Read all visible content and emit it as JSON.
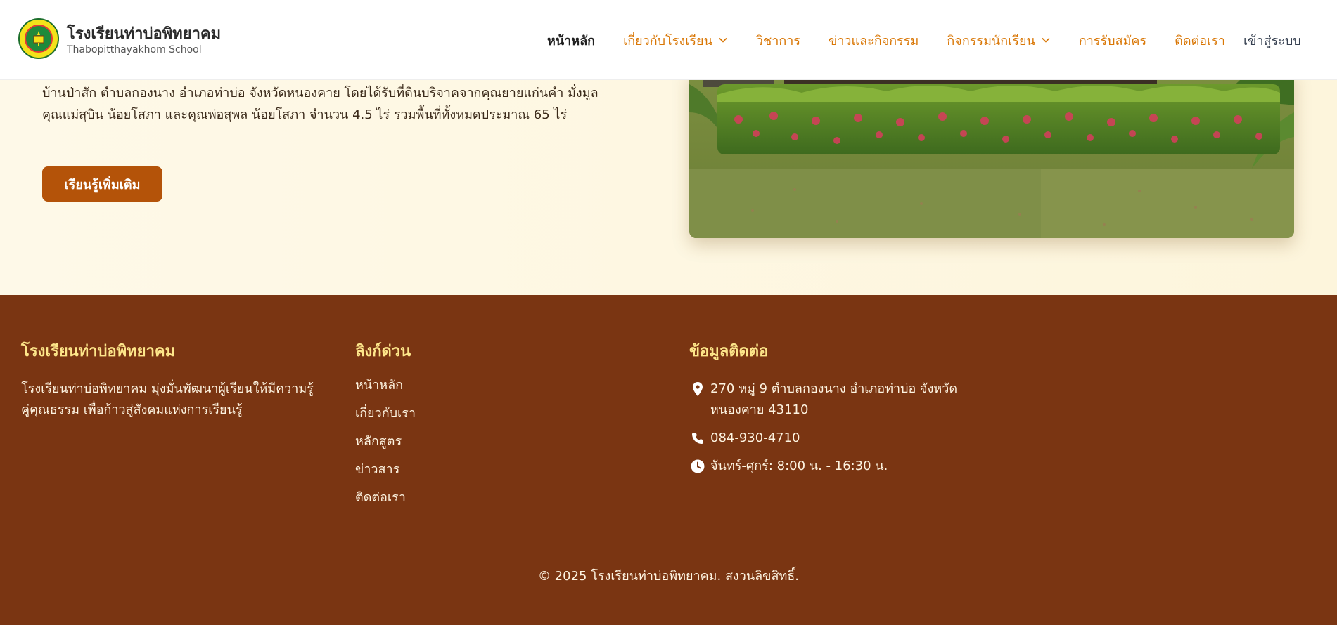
{
  "header": {
    "school_name": "โรงเรียนท่าบ่อพิทยาคม",
    "school_name_en": "Thabopitthayakhom School",
    "nav": [
      {
        "label": "หน้าหลัก",
        "active": true,
        "dropdown": false
      },
      {
        "label": "เกี่ยวกับโรงเรียน",
        "active": false,
        "dropdown": true
      },
      {
        "label": "วิชาการ",
        "active": false,
        "dropdown": false
      },
      {
        "label": "ข่าวและกิจกรรม",
        "active": false,
        "dropdown": false
      },
      {
        "label": "กิจกรรมนักเรียน",
        "active": false,
        "dropdown": true
      },
      {
        "label": "การรับสมัคร",
        "active": false,
        "dropdown": false
      },
      {
        "label": "ติดต่อเรา",
        "active": false,
        "dropdown": false
      }
    ],
    "login_label": "เข้าสู่ระบบ"
  },
  "hero": {
    "text_line1": "บ้านป่าสัก ตำบลกองนาง อำเภอท่าบ่อ จังหวัดหนองคาย โดยได้รับที่ดินบริจาคจากคุณยายแก่นคำ มั่งมูล",
    "text_line2": "คุณแม่สุบิน น้อยโสภา และคุณพ่อสุพล น้อยโสภา จำนวน 4.5 ไร่ รวมพื้นที่ทั้งหมดประมาณ 65 ไร่",
    "button_label": "เรียนรู้เพิ่มเติม"
  },
  "footer": {
    "about_title": "โรงเรียนท่าบ่อพิทยาคม",
    "about_desc": "โรงเรียนท่าบ่อพิทยาคม มุ่งมั่นพัฒนาผู้เรียนให้มีความรู้คู่คุณธรรม เพื่อก้าวสู่สังคมแห่งการเรียนรู้",
    "links_title": "ลิงก์ด่วน",
    "links": [
      "หน้าหลัก",
      "เกี่ยวกับเรา",
      "หลักสูตร",
      "ข่าวสาร",
      "ติดต่อเรา"
    ],
    "contact_title": "ข้อมูลติดต่อ",
    "address": "270 หมู่ 9 ตำบลกองนาง อำเภอท่าบ่อ จังหวัดหนองคาย 43110",
    "phone": "084-930-4710",
    "hours": "จันทร์-ศุกร์: 8:00 น. - 16:30 น.",
    "copyright": "© 2025 โรงเรียนท่าบ่อพิทยาคม. สงวนลิขสิทธิ์."
  },
  "icons": {
    "logo": "school-emblem-icon",
    "chevron": "chevron-down-icon",
    "address": "map-pin-icon",
    "phone": "phone-icon",
    "hours": "clock-icon"
  },
  "colors": {
    "accent": "#d97706",
    "button": "#b45309",
    "footer_bg": "#7a3512",
    "footer_heading": "#fde68a"
  }
}
